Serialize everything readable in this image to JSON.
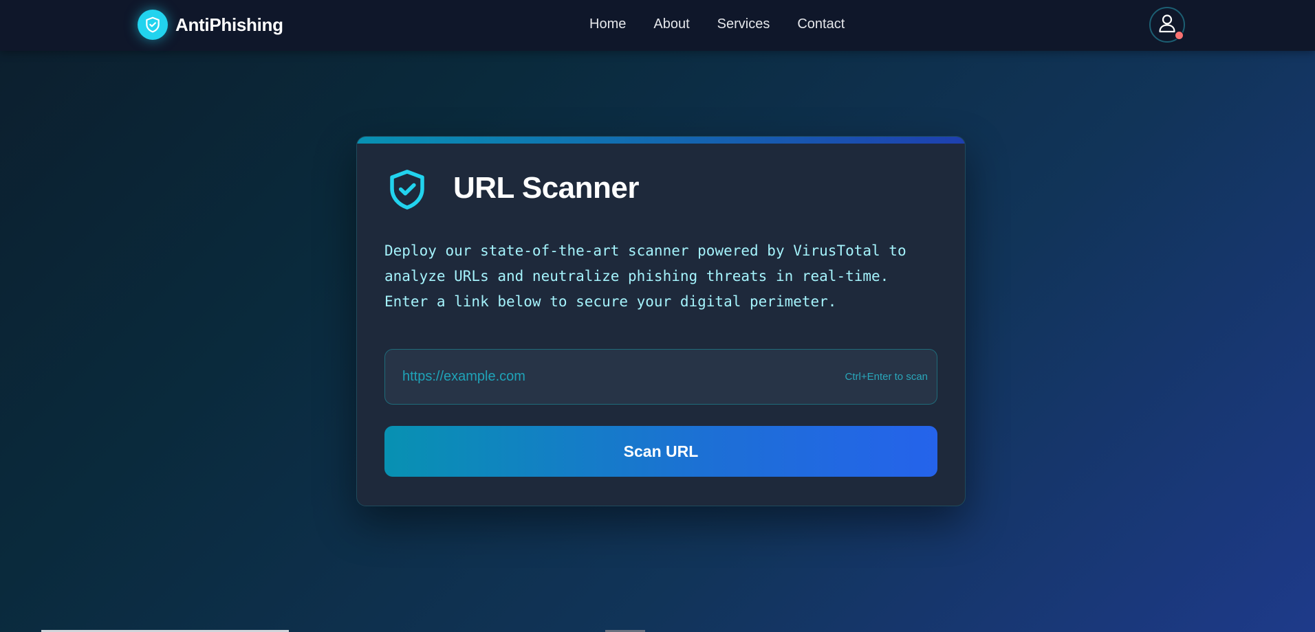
{
  "brand": {
    "name": "AntiPhishing",
    "logo_icon": "shield-check-icon"
  },
  "nav": {
    "links": [
      {
        "label": "Home"
      },
      {
        "label": "About"
      },
      {
        "label": "Services"
      },
      {
        "label": "Contact"
      }
    ]
  },
  "user": {
    "avatar_icon": "user-icon",
    "status_color": "#f87171"
  },
  "scanner": {
    "icon": "shield-check-icon",
    "title": "URL Scanner",
    "description": "Deploy our state-of-the-art scanner powered by VirusTotal to analyze URLs and neutralize phishing threats in real-time. Enter a link below to secure your digital perimeter.",
    "input": {
      "placeholder": "https://example.com",
      "value": ""
    },
    "shortcut_hint": "Ctrl+Enter to scan",
    "button_label": "Scan URL"
  },
  "colors": {
    "accent": "#22d3ee",
    "nav_background": "#0f172a",
    "card_background": "#1e293b",
    "button_gradient_start": "#0891b2",
    "button_gradient_end": "#2563eb"
  }
}
